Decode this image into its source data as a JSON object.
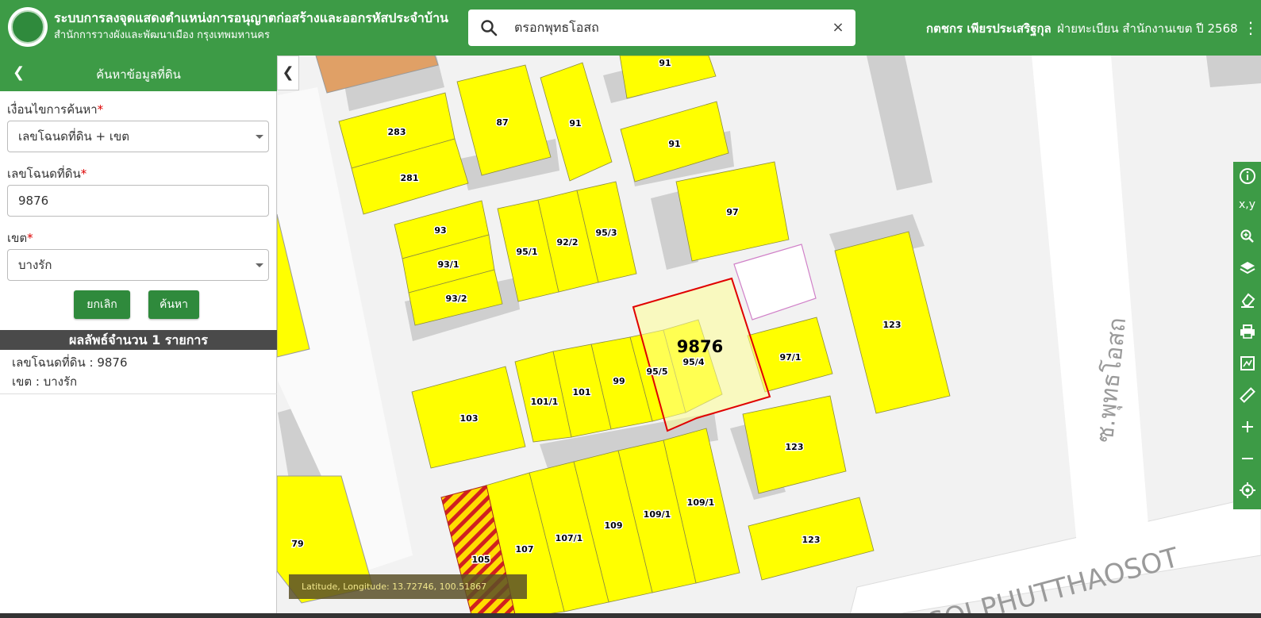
{
  "header": {
    "title": "ระบบการลงจุดแสดงตำแหน่งการอนุญาตก่อสร้างและออกรหัสประจำบ้าน",
    "subtitle": "สำนักการวางผังและพัฒนาเมือง กรุงเทพมหานคร",
    "search_value": "ตรอกพุทธโอสถ",
    "user_name": "กตชกร เพียรประเสริฐกุล",
    "user_dept": "ฝ่ายทะเบียน สำนักงานเขต ปี 2568",
    "clear_icon": "×",
    "more_icon": "⋮"
  },
  "panel": {
    "title": "ค้นหาข้อมูลที่ดิน",
    "criteria_label": "เงื่อนไขการค้นหา",
    "criteria_value": "เลขโฉนดที่ดิน + เขต",
    "deed_label": "เลขโฉนดที่ดิน",
    "deed_value": "9876",
    "district_label": "เขต",
    "district_value": "บางรัก",
    "required_mark": "*",
    "cancel_label": "ยกเลิก",
    "search_label": "ค้นหา",
    "result_title": "ผลลัพธ์จำนวน 1 รายการ",
    "result_deed": "เลขโฉนดที่ดิน : 9876",
    "result_district": "เขต : บางรัก"
  },
  "map": {
    "highlight_label": "9876",
    "road_label": "SOI PHUTTHAOSOT",
    "road_label_thai": "ซ.พุทธโอสถ",
    "coords": "Latitude, Longitude: 13.72746, 100.51867",
    "parcel_labels": [
      "91",
      "87",
      "91",
      "283",
      "281",
      "91",
      "97",
      "93",
      "93/1",
      "93/2",
      "95/1",
      "92/2",
      "95/3",
      "123",
      "97/1",
      "95/5",
      "95/4",
      "99",
      "101",
      "101/1",
      "103",
      "123",
      "109/1",
      "109/1",
      "109",
      "107/1",
      "107",
      "105",
      "123",
      "79"
    ]
  },
  "toolbar": {
    "icons": [
      "info-icon",
      "xy-icon",
      "zoom-icon",
      "layers-icon",
      "eraser-icon",
      "print-icon",
      "map-export-icon",
      "ruler-icon",
      "plus-icon",
      "minus-icon",
      "locate-icon"
    ],
    "xy_label": "x,y"
  },
  "colors": {
    "header_green": "#3d9b46",
    "parcel_yellow": "#ffff00",
    "highlight_red": "#e00000"
  }
}
